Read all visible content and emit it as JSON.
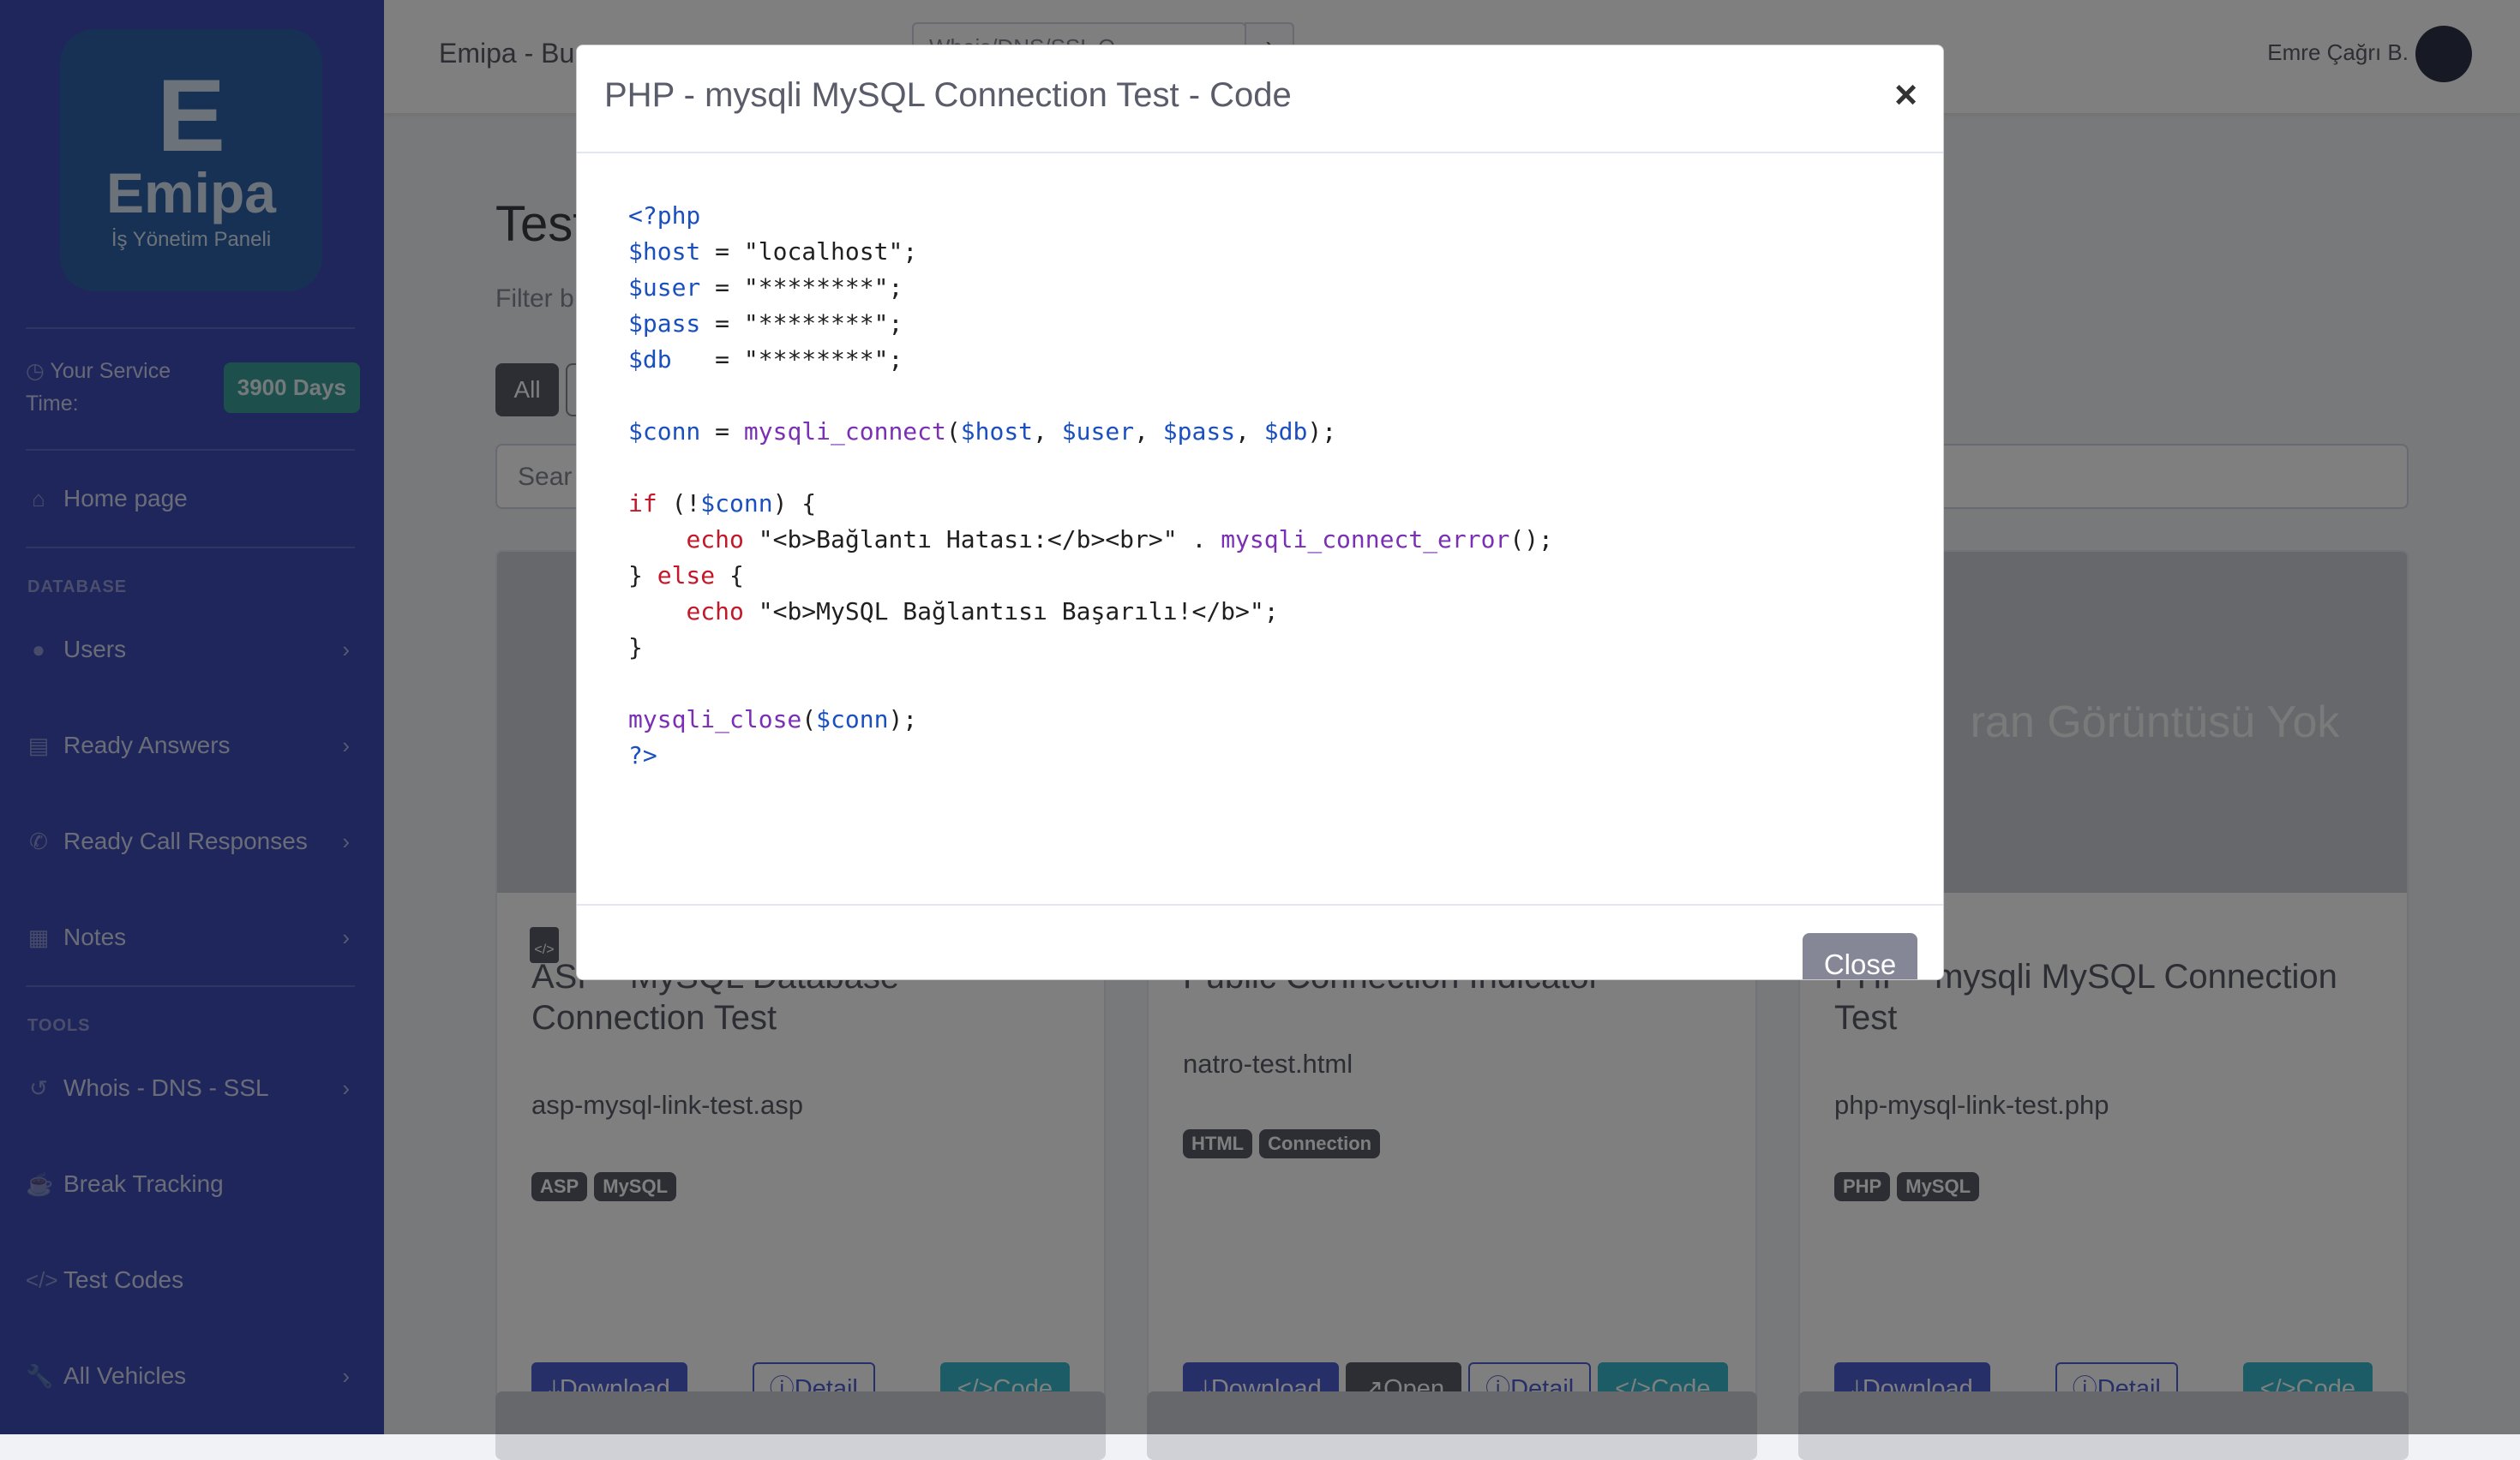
{
  "sidebar": {
    "logo": {
      "mark": "E",
      "name": "Emipa",
      "subtitle": "İş Yönetim Paneli"
    },
    "service_label": "Your Service Time:",
    "service_days": "3900 Days",
    "items": [
      {
        "label": "Home page",
        "icon": "home-icon"
      },
      {
        "label": "Users",
        "icon": "user-icon"
      },
      {
        "label": "Ready Answers",
        "icon": "clipboard-icon"
      },
      {
        "label": "Ready Call Responses",
        "icon": "phone-icon"
      },
      {
        "label": "Notes",
        "icon": "note-icon"
      },
      {
        "label": "Whois - DNS - SSL",
        "icon": "history-icon"
      },
      {
        "label": "Break Tracking",
        "icon": "coffee-icon"
      },
      {
        "label": "Test Codes",
        "icon": "code-icon"
      },
      {
        "label": "All Vehicles",
        "icon": "wrench-icon"
      }
    ],
    "sections": {
      "database": "DATABASE",
      "tools": "TOOLS"
    }
  },
  "topbar": {
    "title": "Emipa - Bu",
    "search_value": "Whois/DNS/SSL Q...",
    "user_name": "Emre Çağrı B."
  },
  "main": {
    "page_title": "Test",
    "filter_label": "Filter b",
    "all_label": "All",
    "search_placeholder": "Sear"
  },
  "cards": [
    {
      "title": "ASP - MySQL Database Connection Test",
      "file": "asp-mysql-link-test.asp",
      "tags": [
        "ASP",
        "MySQL"
      ],
      "download": "Download",
      "detail": "Detail",
      "code": "Code"
    },
    {
      "title": "Public Connection Indicator",
      "file": "natro-test.html",
      "tags": [
        "HTML",
        "Connection"
      ],
      "download": "Download",
      "open": "Open",
      "detail": "Detail",
      "code": "Code"
    },
    {
      "title": "PHP - mysqli MySQL Connection Test",
      "file": "php-mysql-link-test.php",
      "tags": [
        "PHP",
        "MySQL"
      ],
      "no_image_text": "ran Görüntüsü Yok",
      "download": "Download",
      "detail": "Detail",
      "code": "Code"
    }
  ],
  "modal": {
    "title": "PHP - mysqli MySQL Connection Test - Code",
    "close_x": "×",
    "close_label": "Close",
    "code": {
      "open_tag": "<?php",
      "host_val": "\"localhost\"",
      "mask_val": "\"********\"",
      "connect_fn": "mysqli_connect",
      "error_str": "\"<b>Bağlantı Hatası:</b><br>\"",
      "error_fn": "mysqli_connect_error",
      "success_str": "\"<b>MySQL Bağlantısı Başarılı!</b>\"",
      "close_fn": "mysqli_close",
      "close_tag": "?>"
    }
  }
}
